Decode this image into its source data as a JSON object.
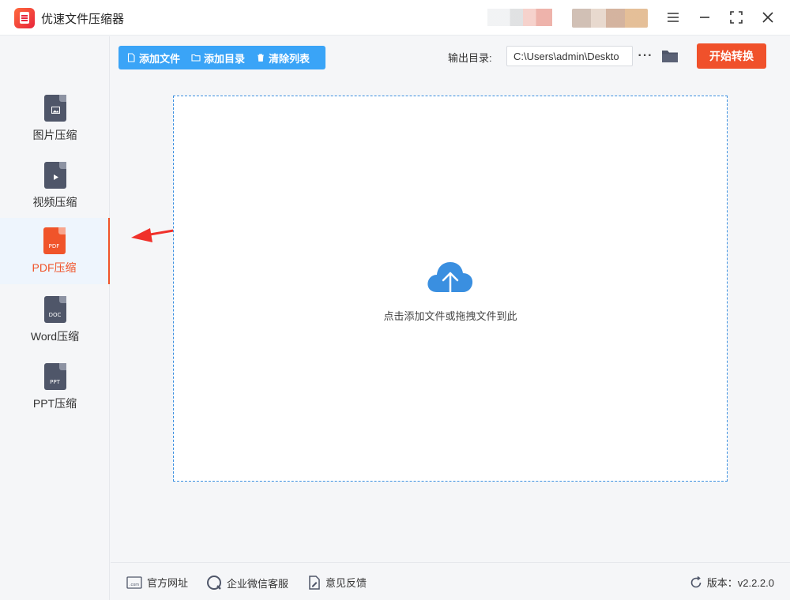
{
  "app": {
    "title": "优速文件压缩器"
  },
  "window_controls": {
    "menu_icon": "menu-icon",
    "minimize_icon": "minimize-icon",
    "maximize_icon": "maximize-icon",
    "close_icon": "close-icon"
  },
  "sidebar": {
    "items": [
      {
        "label": "图片压缩",
        "icon": "image-file-icon",
        "type_text": ""
      },
      {
        "label": "视频压缩",
        "icon": "video-file-icon",
        "type_text": ""
      },
      {
        "label": "PDF压缩",
        "icon": "pdf-file-icon",
        "type_text": "PDF",
        "active": true
      },
      {
        "label": "Word压缩",
        "icon": "doc-file-icon",
        "type_text": "DOC"
      },
      {
        "label": "PPT压缩",
        "icon": "ppt-file-icon",
        "type_text": "PPT"
      }
    ]
  },
  "toolbar": {
    "add_file": "添加文件",
    "add_folder": "添加目录",
    "clear_list": "清除列表",
    "output_label": "输出目录:",
    "output_path": "C:\\Users\\admin\\Deskto",
    "more": "···",
    "start": "开始转换"
  },
  "dropzone": {
    "hint": "点击添加文件或拖拽文件到此"
  },
  "footer": {
    "website": "官方网址",
    "wechat_service": "企业微信客服",
    "feedback": "意见反馈",
    "version": "版本：v2.2.2.0"
  },
  "colors": {
    "accent_blue": "#3aa4f7",
    "accent_orange": "#f0512b",
    "annotation_red": "#f0302a"
  }
}
